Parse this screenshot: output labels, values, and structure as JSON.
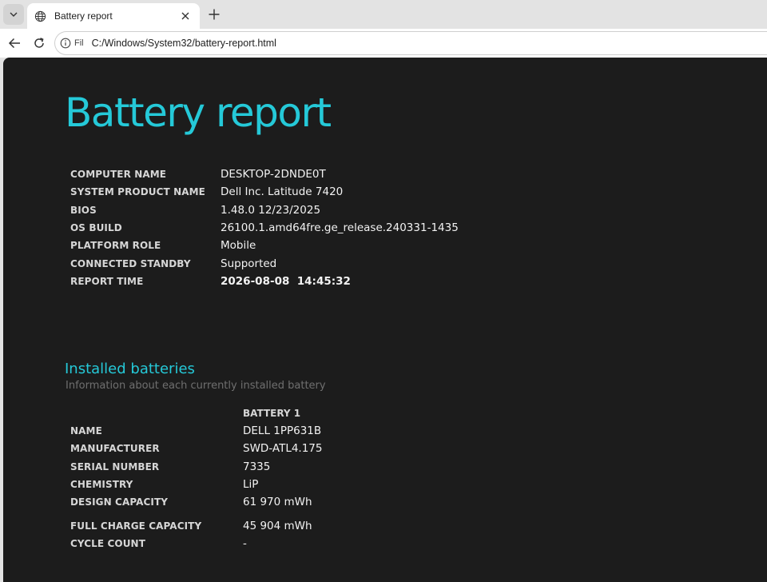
{
  "browser": {
    "tab": {
      "title": "Battery report"
    },
    "address": {
      "site_info_label": "Fil",
      "url": "C:/Windows/System32/battery-report.html"
    }
  },
  "report": {
    "title": "Battery report",
    "system_info": [
      {
        "label": "COMPUTER NAME",
        "value": "DESKTOP-2DNDE0T"
      },
      {
        "label": "SYSTEM PRODUCT NAME",
        "value": "Dell Inc. Latitude 7420"
      },
      {
        "label": "BIOS",
        "value": "1.48.0 12/23/2025"
      },
      {
        "label": "OS BUILD",
        "value": "26100.1.amd64fre.ge_release.240331-1435"
      },
      {
        "label": "PLATFORM ROLE",
        "value": "Mobile"
      },
      {
        "label": "CONNECTED STANDBY",
        "value": "Supported"
      },
      {
        "label": "REPORT TIME",
        "value": "2026-08-08  14:45:32"
      }
    ],
    "installed_batteries": {
      "title": "Installed batteries",
      "subtitle": "Information about each currently installed battery",
      "column_header": "BATTERY 1",
      "rows": [
        {
          "label": "NAME",
          "value": "DELL 1PP631B"
        },
        {
          "label": "MANUFACTURER",
          "value": "SWD-ATL4.175"
        },
        {
          "label": "SERIAL NUMBER",
          "value": "7335"
        },
        {
          "label": "CHEMISTRY",
          "value": "LiP"
        },
        {
          "label": "DESIGN CAPACITY",
          "value": "61 970 mWh"
        },
        {
          "label": "FULL CHARGE CAPACITY",
          "value": "45 904 mWh"
        },
        {
          "label": "CYCLE COUNT",
          "value": "-"
        }
      ]
    }
  },
  "colors": {
    "accent": "#25c9d8",
    "page_bg": "#1c1c1c",
    "subtitle": "#6f6f6f"
  }
}
